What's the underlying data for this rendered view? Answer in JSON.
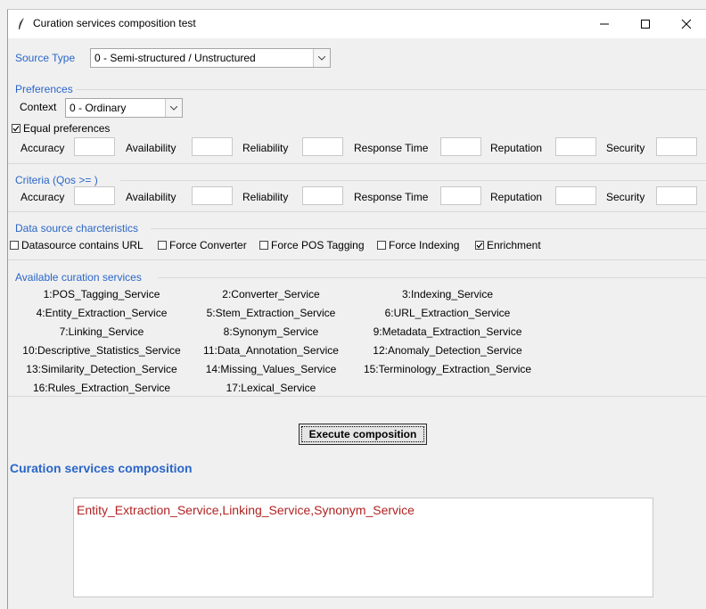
{
  "window": {
    "title": "Curation services composition test"
  },
  "source": {
    "label": "Source Type",
    "selected": "0 - Semi-structured / Unstructured"
  },
  "preferences": {
    "section_label": "Preferences",
    "context_label": "Context",
    "context_selected": "0 - Ordinary",
    "equal_label": "Equal preferences",
    "equal_checked": true,
    "fields": [
      "Accuracy",
      "Availability",
      "Reliability",
      "Response Time",
      "Reputation",
      "Security"
    ]
  },
  "criteria": {
    "section_label": "Criteria (Qos >= )",
    "fields": [
      "Accuracy",
      "Availability",
      "Reliability",
      "Response Time",
      "Reputation",
      "Security"
    ]
  },
  "datasource": {
    "section_label": "Data source charcteristics",
    "options": [
      {
        "label": "Datasource contains URL",
        "checked": false
      },
      {
        "label": "Force Converter",
        "checked": false
      },
      {
        "label": "Force POS Tagging",
        "checked": false
      },
      {
        "label": "Force Indexing",
        "checked": false
      },
      {
        "label": "Enrichment",
        "checked": true
      }
    ]
  },
  "services": {
    "section_label": "Available curation services",
    "items": [
      "1:POS_Tagging_Service",
      "2:Converter_Service",
      "3:Indexing_Service",
      "4:Entity_Extraction_Service",
      "5:Stem_Extraction_Service",
      "6:URL_Extraction_Service",
      "7:Linking_Service",
      "8:Synonym_Service",
      "9:Metadata_Extraction_Service",
      "10:Descriptive_Statistics_Service",
      "11:Data_Annotation_Service",
      "12:Anomaly_Detection_Service",
      "13:Similarity_Detection_Service",
      "14:Missing_Values_Service",
      "15:Terminology_Extraction_Service",
      "16:Rules_Extraction_Service",
      "17:Lexical_Service"
    ]
  },
  "execute": {
    "label": "Execute composition"
  },
  "composition": {
    "heading": "Curation services composition",
    "result": "Entity_Extraction_Service,Linking_Service,Synonym_Service"
  },
  "colors": {
    "section_blue": "#2a66c8",
    "result_red": "#b22222"
  }
}
